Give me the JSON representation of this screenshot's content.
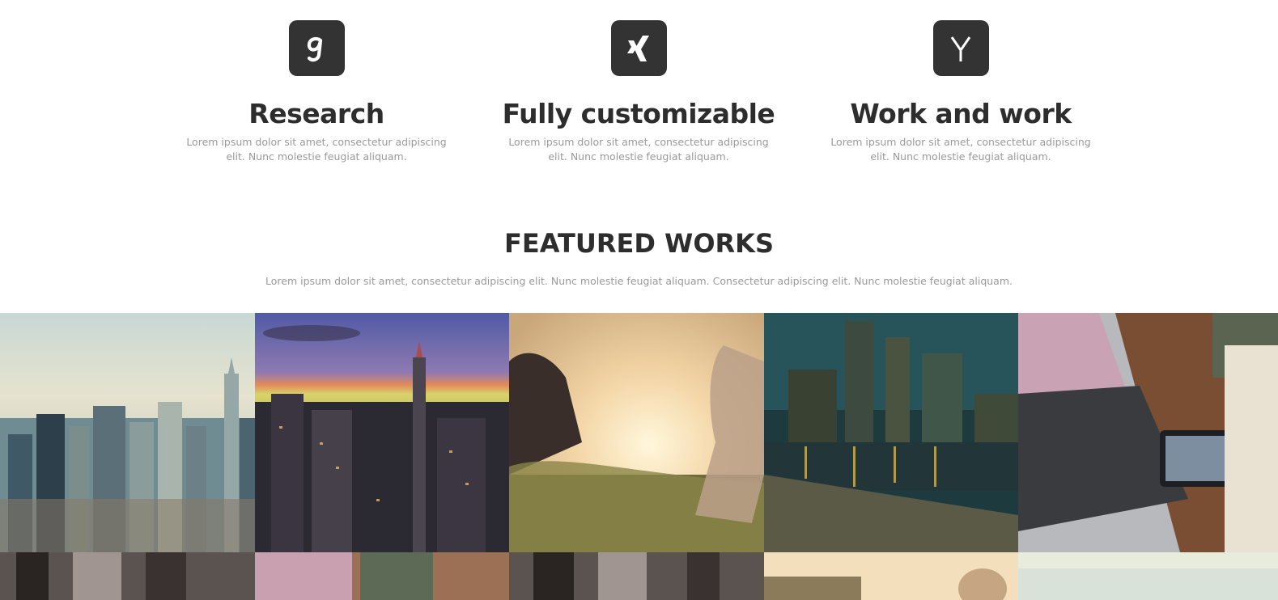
{
  "features": [
    {
      "title": "Research",
      "text": "Lorem ipsum dolor sit amet, consectetur adipiscing elit. Nunc molestie feugiat aliquam.",
      "icon": "gratipay-icon"
    },
    {
      "title": "Fully customizable",
      "text": "Lorem ipsum dolor sit amet, consectetur adipiscing elit. Nunc molestie feugiat aliquam.",
      "icon": "xing-icon"
    },
    {
      "title": "Work and work",
      "text": "Lorem ipsum dolor sit amet, consectetur adipiscing elit. Nunc molestie feugiat aliquam.",
      "icon": "y-combinator-icon"
    }
  ],
  "featured_works": {
    "title": "FEATURED WORKS",
    "subtitle": "Lorem ipsum dolor sit amet, consectetur adipiscing elit. Nunc molestie feugiat aliquam. Consectetur adipiscing elit. Nunc molestie feugiat aliquam."
  },
  "colors": {
    "icon_bg": "#333333",
    "heading": "#2d2d2d",
    "muted_text": "#9a9a9a",
    "background": "#ffffff"
  }
}
